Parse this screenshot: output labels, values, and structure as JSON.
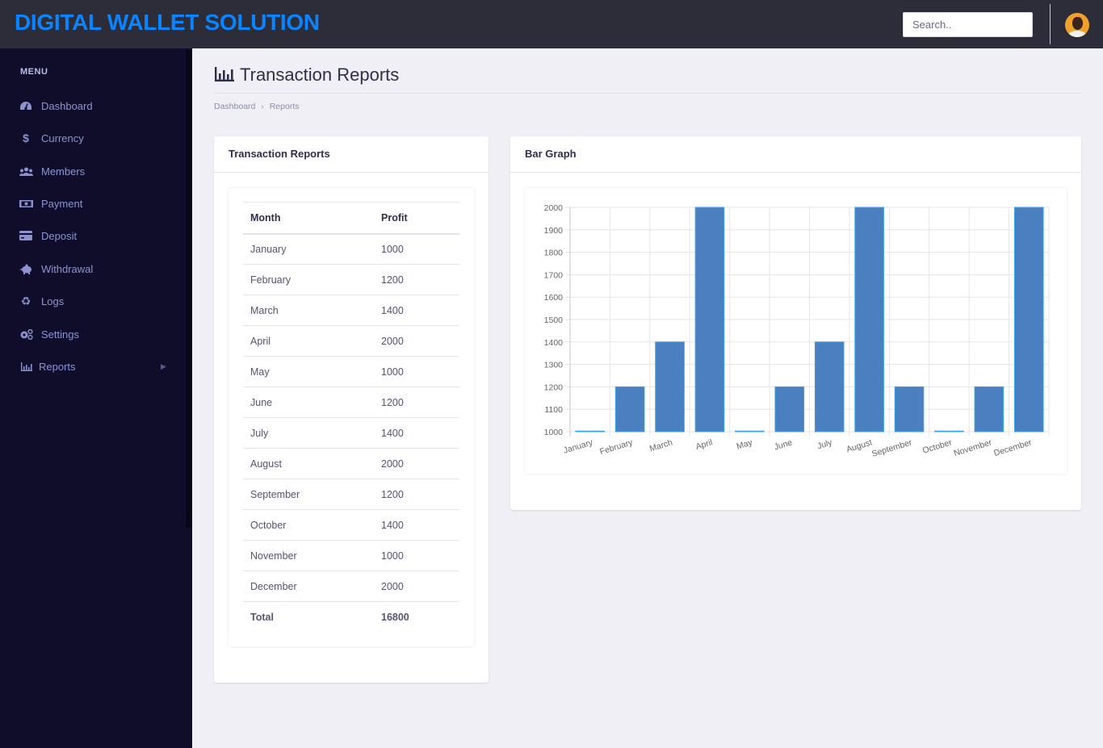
{
  "header": {
    "brand": "DIGITAL WALLET SOLUTION",
    "search_placeholder": "Search..",
    "avatar_icon": "user-avatar"
  },
  "sidebar": {
    "menu_title": "MENU",
    "items": [
      {
        "label": "Dashboard",
        "icon": "tachometer-icon"
      },
      {
        "label": "Currency",
        "icon": "dollar-icon"
      },
      {
        "label": "Members",
        "icon": "users-icon"
      },
      {
        "label": "Payment",
        "icon": "money-bill-icon"
      },
      {
        "label": "Deposit",
        "icon": "credit-card-icon"
      },
      {
        "label": "Withdrawal",
        "icon": "piggy-bank-icon"
      },
      {
        "label": "Logs",
        "icon": "recycle-icon"
      },
      {
        "label": "Settings",
        "icon": "cogs-icon"
      },
      {
        "label": "Reports",
        "icon": "bar-chart-icon",
        "has_submenu": true
      }
    ]
  },
  "page": {
    "title": "Transaction Reports",
    "title_icon": "bar-chart-icon",
    "breadcrumb": [
      "Dashboard",
      "Reports"
    ]
  },
  "reports_card": {
    "title": "Transaction Reports",
    "columns": [
      "Month",
      "Profit"
    ],
    "rows": [
      [
        "January",
        "1000"
      ],
      [
        "February",
        "1200"
      ],
      [
        "March",
        "1400"
      ],
      [
        "April",
        "2000"
      ],
      [
        "May",
        "1000"
      ],
      [
        "June",
        "1200"
      ],
      [
        "July",
        "1400"
      ],
      [
        "August",
        "2000"
      ],
      [
        "September",
        "1200"
      ],
      [
        "October",
        "1400"
      ],
      [
        "November",
        "1000"
      ],
      [
        "December",
        "2000"
      ]
    ],
    "total_label": "Total",
    "total_value": "16800"
  },
  "graph_card": {
    "title": "Bar Graph"
  },
  "chart_data": {
    "type": "bar",
    "title": "",
    "xlabel": "",
    "ylabel": "",
    "categories": [
      "January",
      "February",
      "March",
      "April",
      "May",
      "June",
      "July",
      "August",
      "September",
      "October",
      "November",
      "December"
    ],
    "values": [
      1000,
      1200,
      1400,
      2000,
      1000,
      1200,
      1400,
      2000,
      1200,
      1000,
      1200,
      2000
    ],
    "ylim": [
      1000,
      2000
    ],
    "yticks": [
      1000,
      1100,
      1200,
      1300,
      1400,
      1500,
      1600,
      1700,
      1800,
      1900,
      2000
    ],
    "grid": true,
    "legend": "none",
    "bar_color": "#4a80bf",
    "bar_border_color": "#36a2eb"
  }
}
